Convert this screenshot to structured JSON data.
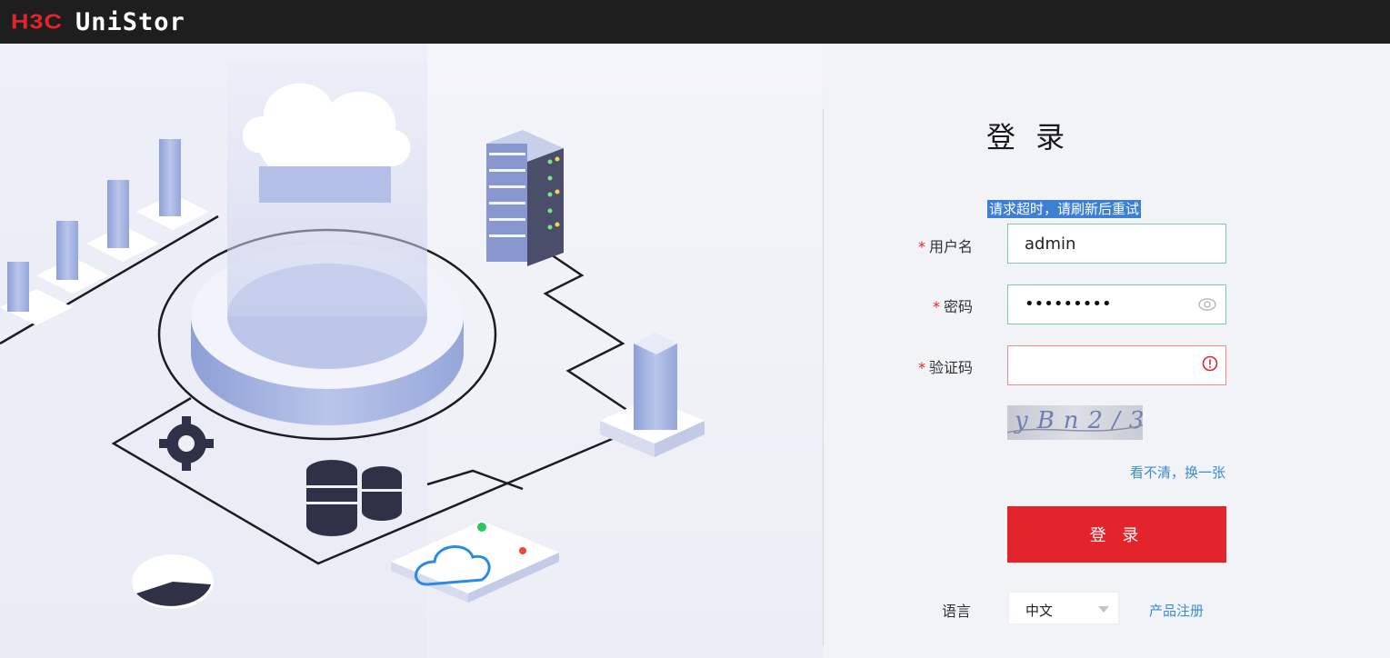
{
  "header": {
    "brand": "H3C",
    "product": "UniStor"
  },
  "login": {
    "title": "登 录",
    "error_message": "请求超时，请刷新后重试",
    "username_label": "用户名",
    "username_value": "admin",
    "password_label": "密码",
    "password_value": "•••••••••",
    "captcha_label": "验证码",
    "captcha_value": "",
    "captcha_image_text": "yBn2/3",
    "refresh_captcha_link": "看不清，换一张",
    "submit_label": "登 录",
    "required_marker": "*"
  },
  "footer": {
    "language_label": "语言",
    "language_value": "中文",
    "register_link": "产品注册"
  },
  "colors": {
    "brand_red": "#e3242b",
    "link_blue": "#3a8bd3",
    "valid_border": "#7fc7a4",
    "error_border": "#ef8a8a"
  },
  "icons": [
    "eye-icon",
    "alert-icon",
    "chevron-down-icon",
    "gear-icon",
    "cloud-icon",
    "database-icon",
    "server-icon"
  ]
}
